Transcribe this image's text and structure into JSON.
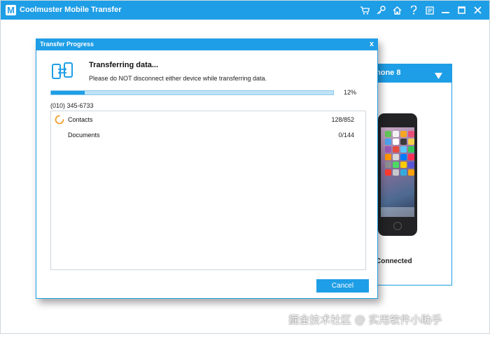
{
  "app": {
    "title": "Coolmuster Mobile Transfer",
    "logo_letter": "M",
    "toolbar_icons": [
      "cart-icon",
      "key-icon",
      "home-icon",
      "help-icon",
      "feedback-icon",
      "minimize-icon",
      "maximize-icon",
      "close-icon"
    ],
    "accent_color": "#1e9ee6"
  },
  "device": {
    "name": "hone 8",
    "status": "Connected"
  },
  "modal": {
    "title": "Transfer Progress",
    "close_label": "x",
    "heading": "Transferring data...",
    "subtext": "Please do NOT disconnect either device while transferring data.",
    "progress_percent": 12,
    "progress_label": "12%",
    "phone_number": "(010) 345-6733",
    "items": [
      {
        "label": "Contacts",
        "count": "128/852",
        "status": "in-progress"
      },
      {
        "label": "Documents",
        "count": "0/144",
        "status": "pending"
      }
    ],
    "cancel_label": "Cancel"
  },
  "watermark": "掘金技术社区 @ 实用软件小助手"
}
